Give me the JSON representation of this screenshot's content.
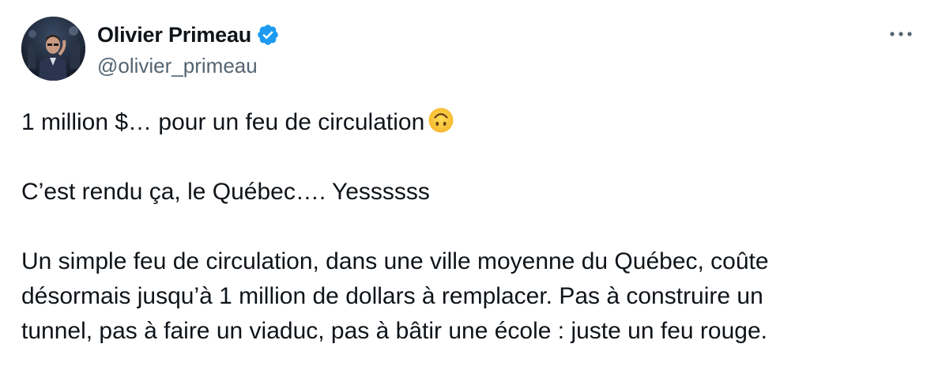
{
  "author": {
    "display_name": "Olivier Primeau",
    "handle": "@olivier_primeau",
    "verified": true,
    "verified_color": "#1d9bf0"
  },
  "menu_icon": "more-horizontal-icon",
  "tweet": {
    "line1": "1 million $… pour un feu de circulation",
    "line1_emoji": "upside-down-face-emoji",
    "line2": "C’est rendu ça, le Québec…. Yessssss",
    "line3a": "Un simple feu de circulation, dans une ville moyenne du Québec, coûte",
    "line3b": "désormais jusqu’à 1 million de dollars à remplacer. Pas à construire un",
    "line3c": "tunnel, pas à faire un viaduc, pas à bâtir une école : juste un feu rouge."
  },
  "colors": {
    "text": "#0f1419",
    "secondary": "#536471",
    "accent": "#1d9bf0"
  }
}
